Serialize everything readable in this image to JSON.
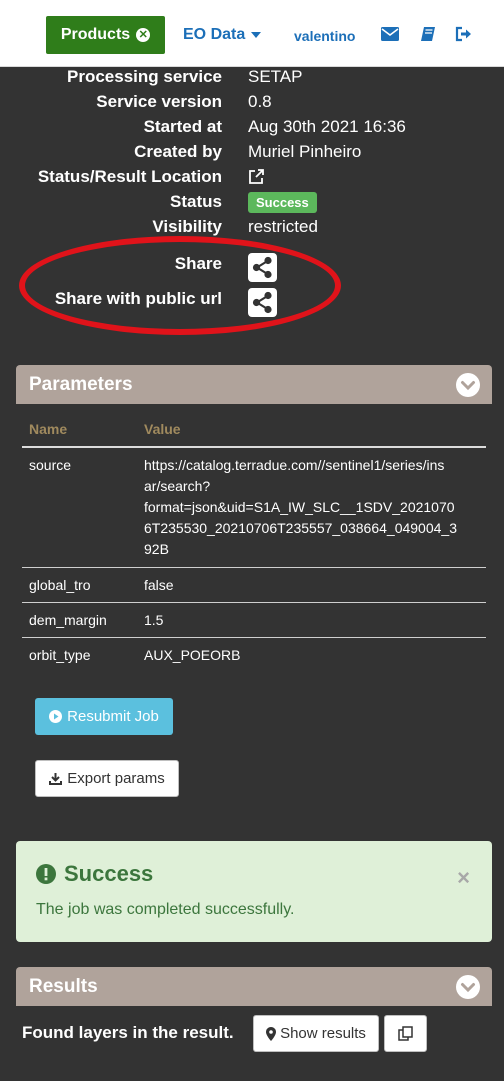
{
  "nav": {
    "products_label": "Products",
    "eo_data_label": "EO Data",
    "user_label": "valentino"
  },
  "info": [
    {
      "label": "Processing service",
      "value": "SETAP"
    },
    {
      "label": "Service version",
      "value": "0.8"
    },
    {
      "label": "Started at",
      "value": "Aug 30th 2021 16:36"
    },
    {
      "label": "Created by",
      "value": "Muriel Pinheiro"
    },
    {
      "label": "Status/Result Location",
      "value": ""
    },
    {
      "label": "Status",
      "value": "Success"
    },
    {
      "label": "Visibility",
      "value": "restricted"
    }
  ],
  "share": {
    "share_label": "Share",
    "public_label": "Share with public url"
  },
  "parameters": {
    "title": "Parameters",
    "columns": [
      "Name",
      "Value"
    ],
    "rows": [
      {
        "name": "source",
        "value": [
          "https://catalog.terradue.com//sentinel1/series/ins",
          "ar/search?",
          "format=json&uid=S1A_IW_SLC__1SDV_2021070",
          "6T235530_20210706T235557_038664_049004_3",
          "92B"
        ]
      },
      {
        "name": "global_tro",
        "value": [
          "false"
        ]
      },
      {
        "name": "dem_margin",
        "value": [
          "1.5"
        ]
      },
      {
        "name": "orbit_type",
        "value": [
          "AUX_POEORB"
        ]
      }
    ],
    "resubmit_label": "Resubmit Job",
    "export_label": "Export params"
  },
  "alert": {
    "title": "Success",
    "message": "The job was completed successfully.",
    "close": "×"
  },
  "results": {
    "title": "Results",
    "found_text": "Found layers in the result.",
    "show_label": "Show results"
  },
  "colors": {
    "products_green": "#2f7d1a",
    "link_blue": "#1c6fb8",
    "panel_header": "#b0a39b",
    "success_badge": "#5cb85c",
    "alert_bg": "#dff0d8",
    "resubmit_bg": "#5bc0de",
    "annotation_red": "#e0131a"
  }
}
